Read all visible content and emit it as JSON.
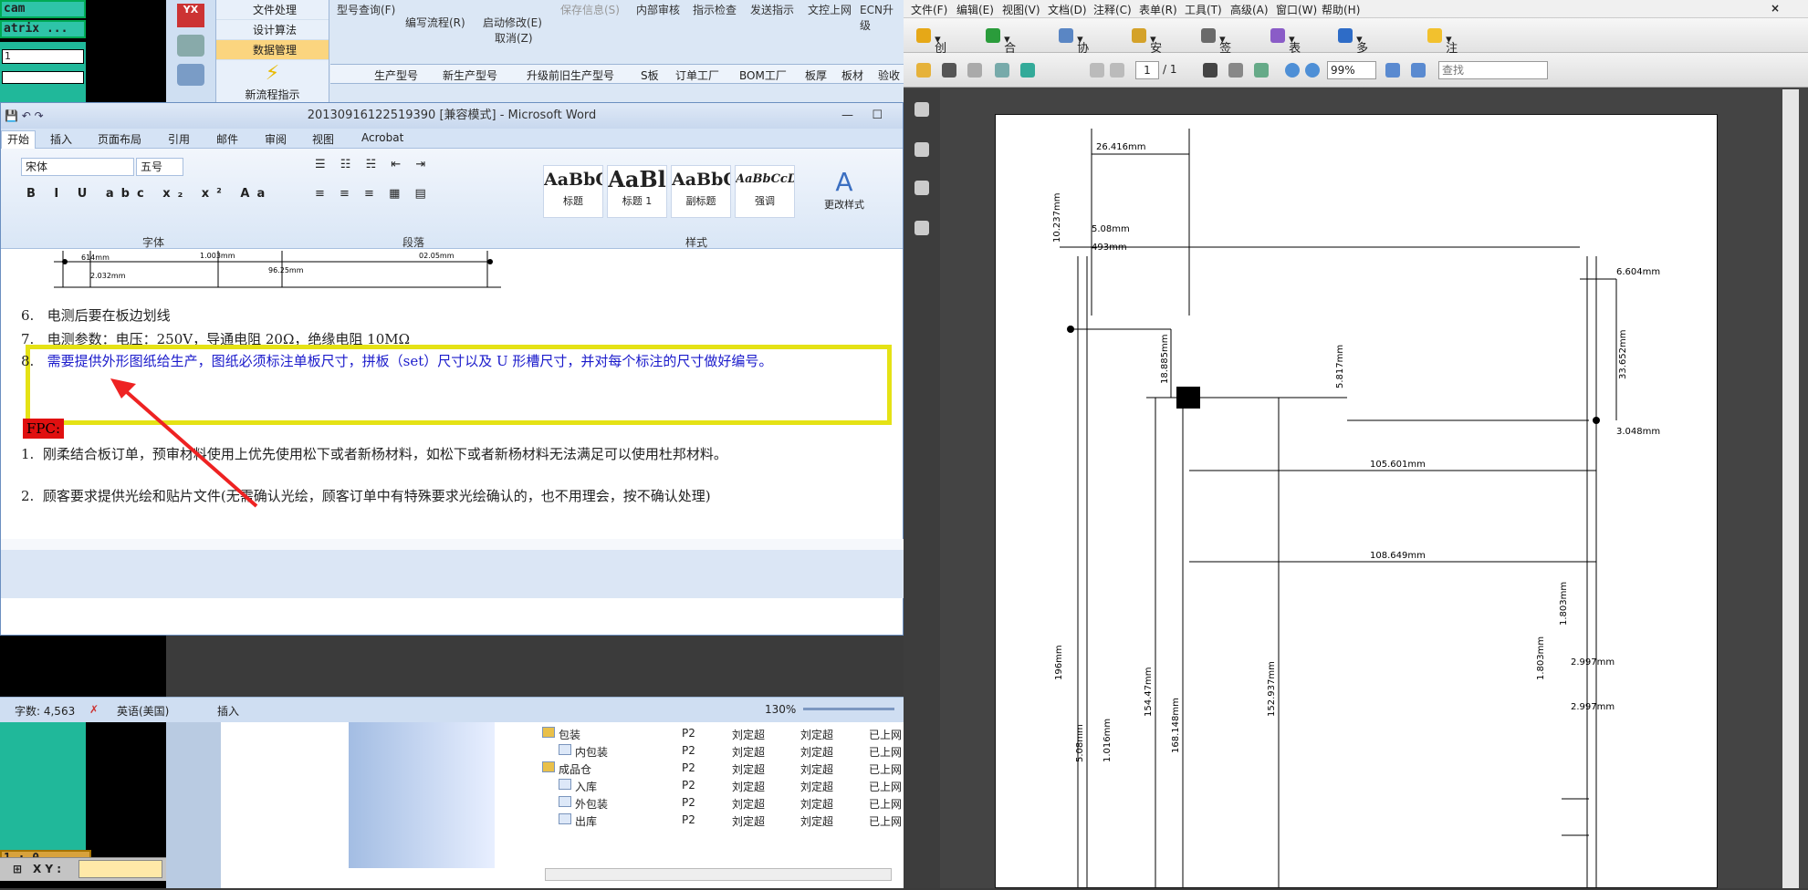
{
  "cam": {
    "label_cam": "cam",
    "label_matrix": "atrix ...",
    "label_1": "1",
    "coord": "1 : 0",
    "xy_label": "X Y :"
  },
  "pdm": {
    "nav": [
      "文件处理",
      "设计算法",
      "数据管理"
    ],
    "new_flow": "新流程指示",
    "menu": [
      {
        "label": "型号查询(F)"
      },
      {
        "label": "编写流程(R)"
      },
      {
        "label": "启动修改(E)"
      },
      {
        "label": "取消(Z)"
      },
      {
        "label": "保存信息(S)"
      },
      {
        "label": "内部审核"
      },
      {
        "label": "指示检查"
      },
      {
        "label": "发送指示"
      },
      {
        "label": "文控上网"
      },
      {
        "label": "ECN升级"
      }
    ],
    "tabs": [
      "生产型号",
      "新生产型号",
      "升级前旧生产型号",
      "S板",
      "订单工厂",
      "BOM工厂",
      "板厚",
      "板材",
      "验收"
    ]
  },
  "word": {
    "title": "20130916122519390 [兼容模式] - Microsoft Word",
    "tabs": [
      "开始",
      "插入",
      "页面布局",
      "引用",
      "邮件",
      "审阅",
      "视图",
      "Acrobat"
    ],
    "font_name": "宋体",
    "font_size": "五号",
    "groups": [
      "字体",
      "段落",
      "样式"
    ],
    "styles": [
      {
        "preview": "AaBbC",
        "name": "标题"
      },
      {
        "preview": "AaBl",
        "name": "标题 1"
      },
      {
        "preview": "AaBbC",
        "name": "副标题"
      },
      {
        "preview": "AaBbCcD",
        "name": "强调"
      }
    ],
    "change_styles": "更改样式",
    "drawing_dims": [
      "614mm",
      "2.032mm",
      "1.003mm",
      "96.25mm",
      "02.05mm"
    ],
    "items": [
      {
        "num": "6.",
        "text": "电测后要在板边划线"
      },
      {
        "num": "7.",
        "text": "电测参数：电压：250V，导通电阻 20Ω，绝缘电阻 10MΩ"
      },
      {
        "num": "8.",
        "text": "需要提供外形图纸给生产，图纸必须标注单板尺寸，拼板（set）尺寸以及 U 形槽尺寸，并对每个标注的尺寸做好编号。"
      }
    ],
    "fpc_label": "FPC:",
    "fpc_items": [
      {
        "num": "1.",
        "text": "刚柔结合板订单，预审材料使用上优先使用松下或者新杨材料，如松下或者新杨材料无法满足可以使用杜邦材料。"
      },
      {
        "num": "2.",
        "text": "顾客要求提供光绘和贴片文件(无需确认光绘，顾客订单中有特殊要求光绘确认的，也不用理会，按不确认处理)"
      }
    ]
  },
  "status": {
    "words": "字数: 4,563",
    "lang": "英语(美国)",
    "mode": "插入",
    "zoom": "130%"
  },
  "tree": {
    "rows": [
      {
        "name": "包装",
        "level": 1,
        "c1": "P2",
        "c2": "刘定超",
        "c3": "刘定超",
        "c4": "已上网"
      },
      {
        "name": "内包装",
        "level": 2,
        "c1": "P2",
        "c2": "刘定超",
        "c3": "刘定超",
        "c4": "已上网"
      },
      {
        "name": "成品仓",
        "level": 1,
        "c1": "P2",
        "c2": "刘定超",
        "c3": "刘定超",
        "c4": "已上网"
      },
      {
        "name": "入库",
        "level": 2,
        "c1": "P2",
        "c2": "刘定超",
        "c3": "刘定超",
        "c4": "已上网"
      },
      {
        "name": "外包装",
        "level": 2,
        "c1": "P2",
        "c2": "刘定超",
        "c3": "刘定超",
        "c4": "已上网"
      },
      {
        "name": "出库",
        "level": 2,
        "c1": "P2",
        "c2": "刘定超",
        "c3": "刘定超",
        "c4": "已上网"
      }
    ]
  },
  "pdf": {
    "menu": [
      "文件(F)",
      "编辑(E)",
      "视图(V)",
      "文档(D)",
      "注释(C)",
      "表单(R)",
      "工具(T)",
      "高级(A)",
      "窗口(W)",
      "帮助(H)"
    ],
    "toolbar": [
      "创建",
      "合并",
      "协作",
      "安全",
      "签名",
      "表单",
      "多媒体",
      "注释"
    ],
    "page_num": "1",
    "page_total": "/ 1",
    "zoom": "99%",
    "search_placeholder": "查找",
    "dims": {
      "d1": "26.416mm",
      "d2": "10.237mm",
      "d3": "5.08mm",
      "d4": "493mm",
      "d5": "6.604mm",
      "d6": "18.885mm",
      "d7": "5.817mm",
      "d8": "33.652mm",
      "d9": "3.048mm",
      "d10": "105.601mm",
      "d11": "108.649mm",
      "d12": "196mm",
      "d13": "154.47mm",
      "d14": "168.148mm",
      "d15": "152.937mm",
      "d16": "5.08mm",
      "d17": "1.016mm",
      "d18": "1.803mm",
      "d19": "1.803mm",
      "d20": "2.997mm",
      "d21": "2.997mm"
    }
  }
}
